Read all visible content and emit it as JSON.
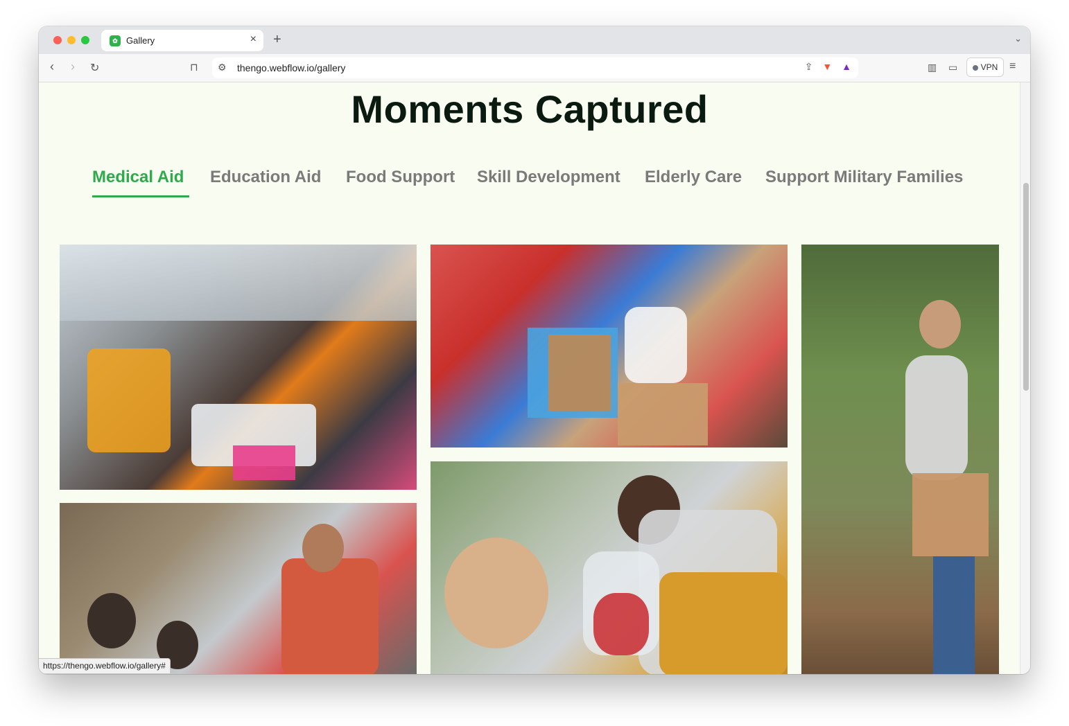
{
  "browser": {
    "tab_title": "Gallery",
    "url": "thengo.webflow.io/gallery",
    "vpn_label": "VPN",
    "status_url": "https://thengo.webflow.io/gallery#"
  },
  "page": {
    "heading": "Moments Captured",
    "accent_color": "#2eaa4d",
    "filters": [
      {
        "label": "Medical Aid",
        "active": true
      },
      {
        "label": "Education Aid",
        "active": false
      },
      {
        "label": "Food Support",
        "active": false
      },
      {
        "label": "Skill Development",
        "active": false
      },
      {
        "label": "Elderly Care",
        "active": false
      },
      {
        "label": "Support Military Families",
        "active": false
      }
    ],
    "gallery": [
      {
        "name": "photo-refugee-camp-distribution"
      },
      {
        "name": "photo-volunteers-packing-boxes"
      },
      {
        "name": "photo-volunteer-handing-box"
      },
      {
        "name": "photo-children-food-handout"
      },
      {
        "name": "photo-girl-receiving-apples"
      }
    ]
  }
}
